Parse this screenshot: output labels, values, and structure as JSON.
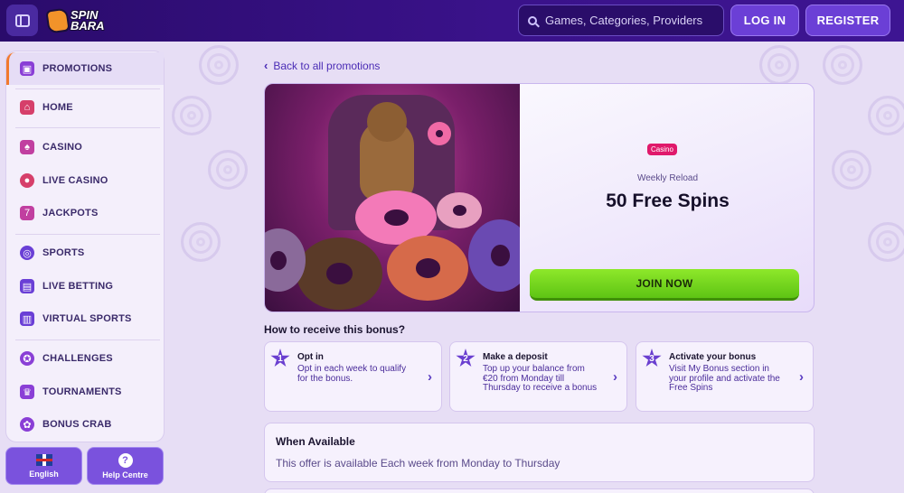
{
  "header": {
    "logo_text": "SPIN BARA",
    "search_placeholder": "Games, Categories, Providers",
    "login_label": "LOG IN",
    "register_label": "REGISTER"
  },
  "sidebar": {
    "items": [
      {
        "label": "PROMOTIONS",
        "icon": "gift-icon",
        "active": true,
        "color": "#8a3fd6"
      },
      {
        "label": "HOME",
        "icon": "home-icon",
        "color": "#d63f6a"
      },
      {
        "label": "CASINO",
        "icon": "casino-icon",
        "color": "#c13fa0"
      },
      {
        "label": "LIVE CASINO",
        "icon": "roulette-icon",
        "color": "#d63f6a"
      },
      {
        "label": "JACKPOTS",
        "icon": "jackpot-icon",
        "color": "#c13fa0"
      },
      {
        "label": "SPORTS",
        "icon": "ball-icon",
        "color": "#6a3fd6"
      },
      {
        "label": "LIVE BETTING",
        "icon": "live-icon",
        "color": "#6a3fd6"
      },
      {
        "label": "VIRTUAL SPORTS",
        "icon": "virtual-icon",
        "color": "#6a3fd6"
      },
      {
        "label": "CHALLENGES",
        "icon": "challenge-icon",
        "color": "#8a3fd6"
      },
      {
        "label": "TOURNAMENTS",
        "icon": "trophy-icon",
        "color": "#8a3fd6"
      },
      {
        "label": "BONUS CRAB",
        "icon": "crab-icon",
        "color": "#8a3fd6"
      }
    ],
    "language_label": "English",
    "help_label": "Help Centre"
  },
  "main": {
    "back_label": "Back to all promotions",
    "promo": {
      "tag": "Casino",
      "subtitle": "Weekly Reload",
      "title": "50 Free Spins",
      "cta": "JOIN NOW"
    },
    "how_title": "How to receive this bonus?",
    "steps": [
      {
        "num": "1",
        "title": "Opt in",
        "desc": "Opt in each week to qualify for the bonus."
      },
      {
        "num": "2",
        "title": "Make a deposit",
        "desc": "Top up your balance from €20 from Monday till Thursday to receive a bonus"
      },
      {
        "num": "3",
        "title": "Activate your bonus",
        "desc": "Visit My Bonus section in your profile and activate the Free Spins"
      }
    ],
    "availability": {
      "title": "When Available",
      "text": "This offer is available Each week from Monday to Thursday"
    }
  },
  "colors": {
    "header_bg": "#2a0b6b",
    "accent_purple": "#6b3fd6",
    "cta_green": "#7ad820",
    "tag_pink": "#e0196b",
    "active_marker": "#f17a2e"
  }
}
